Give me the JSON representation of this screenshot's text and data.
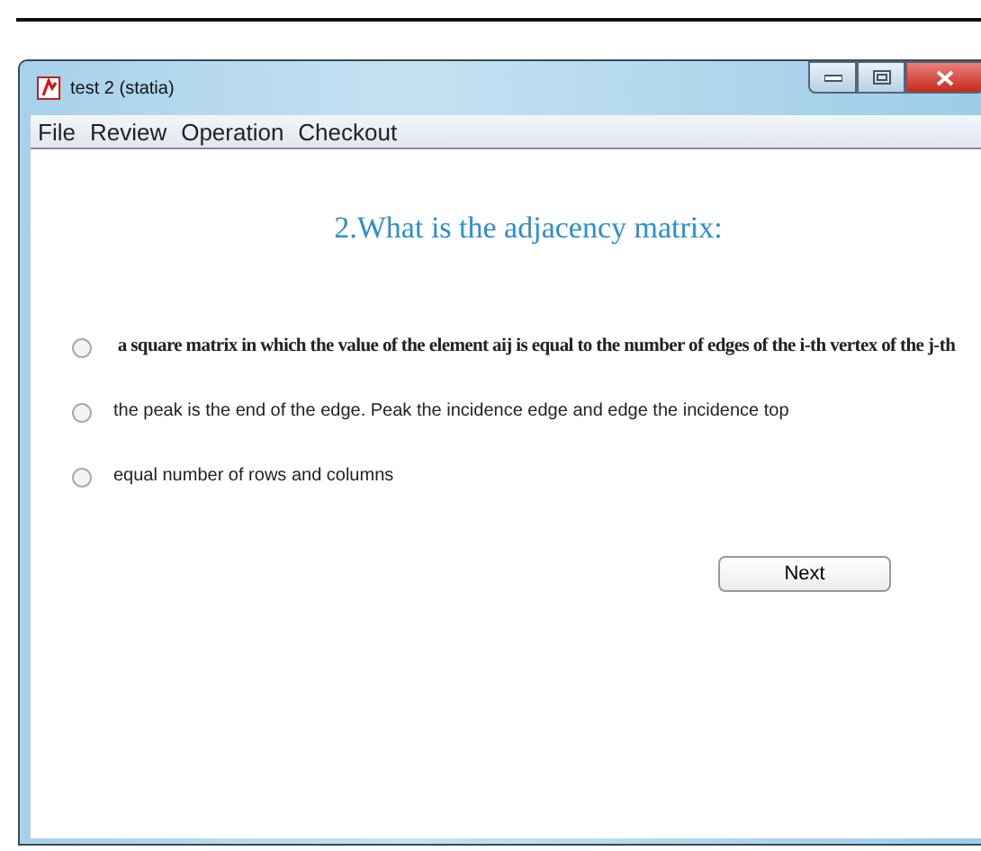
{
  "window": {
    "title": "test 2 (statia)"
  },
  "menu": [
    "File",
    "Review",
    "Operation",
    "Checkout"
  ],
  "question": "2.What is the adjacency matrix:",
  "options": [
    {
      "text": "a square matrix in which the value of the element aij is equal to the number of edges of the i-th vertex of the j-th",
      "selected": false,
      "kind": "serif"
    },
    {
      "text": "the peak is the end of the edge. Peak the incidence edge and edge the incidence top",
      "selected": false,
      "kind": "sans"
    },
    {
      "text": "equal number of rows and columns",
      "selected": false,
      "kind": "sans"
    }
  ],
  "next_button": "Next"
}
